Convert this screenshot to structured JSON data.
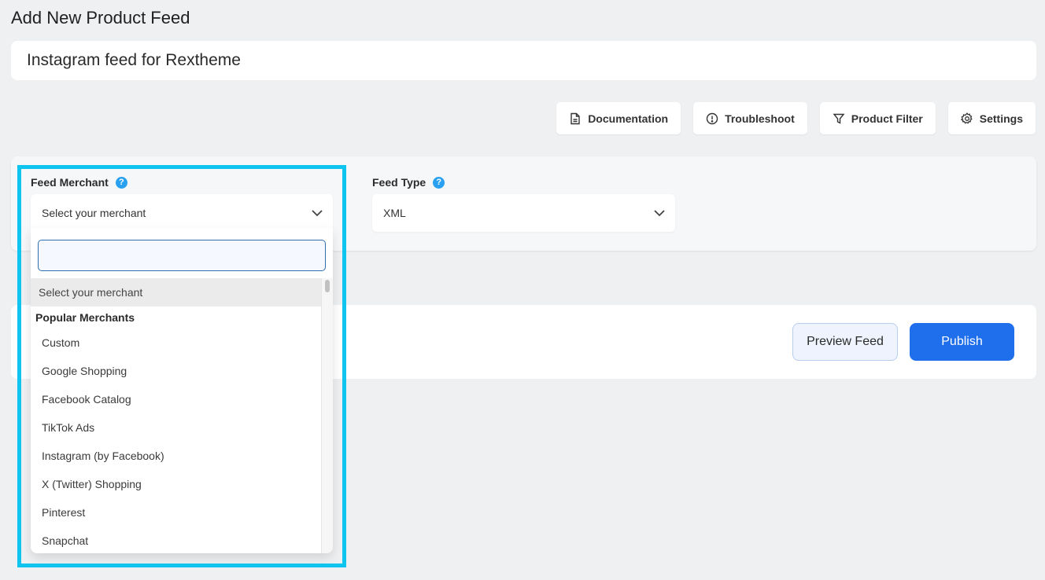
{
  "page": {
    "title": "Add New Product Feed",
    "feed_name_value": "Instagram feed for Rextheme"
  },
  "toolbar": {
    "buttons": [
      {
        "label": "Documentation",
        "icon": "document-icon"
      },
      {
        "label": "Troubleshoot",
        "icon": "alert-circle-icon"
      },
      {
        "label": "Product Filter",
        "icon": "filter-icon"
      },
      {
        "label": "Settings",
        "icon": "gear-icon"
      }
    ]
  },
  "config": {
    "merchant_label": "Feed Merchant",
    "merchant_selected": "Select your merchant",
    "feed_type_label": "Feed Type",
    "feed_type_selected": "XML",
    "help_glyph": "?"
  },
  "dropdown": {
    "search_value": "",
    "placeholder_option": "Select your merchant",
    "group_label": "Popular Merchants",
    "options": [
      "Custom",
      "Google Shopping",
      "Facebook Catalog",
      "TikTok Ads",
      "Instagram (by Facebook)",
      "X (Twitter) Shopping",
      "Pinterest",
      "Snapchat"
    ]
  },
  "actions": {
    "preview_label": "Preview Feed",
    "publish_label": "Publish"
  },
  "colors": {
    "accent": "#1f6fec",
    "highlight": "#10c4f0",
    "help": "#2aa1f0"
  }
}
